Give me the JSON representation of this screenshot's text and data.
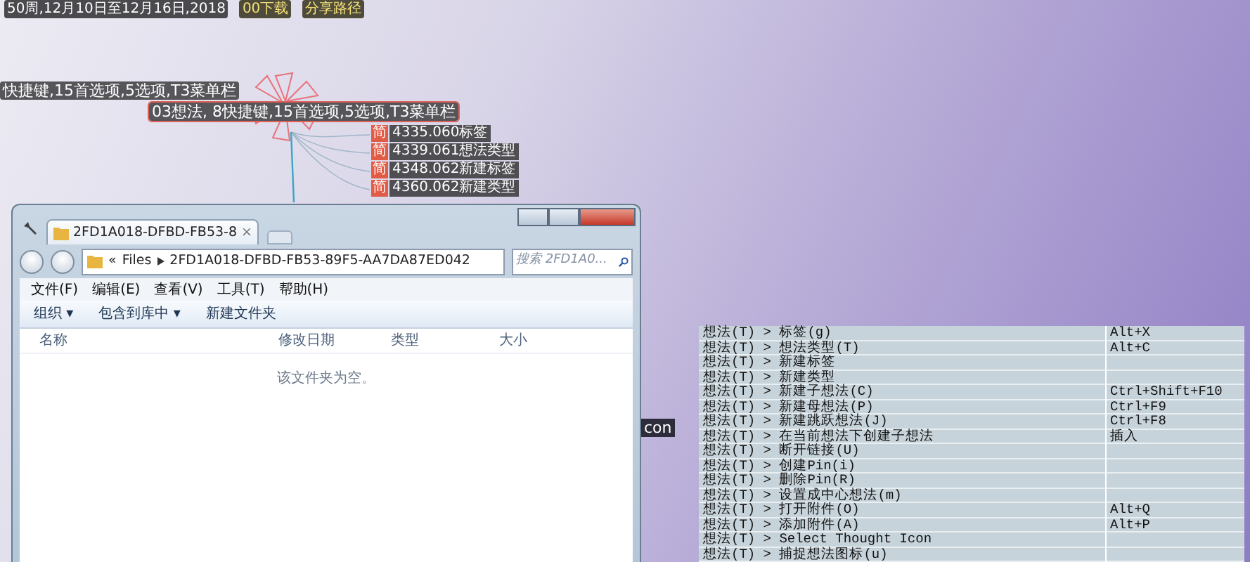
{
  "header_tags": [
    {
      "text": "50周,12月10日至12月16日,2018",
      "kind": "date"
    },
    {
      "text": "00下载",
      "kind": "folder"
    },
    {
      "text": "分享路径",
      "kind": "folder"
    }
  ],
  "thoughts": [
    {
      "text": "快捷键,15首选项,5选项,T3菜单栏",
      "kind": "plain"
    },
    {
      "text": "03想法, 8快捷键,15首选项,5选项,T3菜单栏",
      "kind": "active"
    }
  ],
  "child_thoughts": [
    {
      "badge": "简",
      "text": "4335.060标签"
    },
    {
      "badge": "简",
      "text": "4339.061想法类型"
    },
    {
      "badge": "简",
      "text": "4348.062新建标签"
    },
    {
      "badge": "简",
      "text": "4360.062新建类型"
    }
  ],
  "partial_label": "con",
  "explorer": {
    "tab": "2FD1A018-DFBD-FB53-8",
    "tab_close": "×",
    "address_prefix": "«",
    "breadcrumb": [
      "Files",
      "2FD1A018-DFBD-FB53-89F5-AA7DA87ED042"
    ],
    "search": {
      "placeholder": "搜索 2FD1A0..."
    },
    "menu": [
      "文件(F)",
      "编辑(E)",
      "查看(V)",
      "工具(T)",
      "帮助(H)"
    ],
    "toolbar": [
      {
        "label": "组织",
        "caret": "▾"
      },
      {
        "label": "包含到库中",
        "caret": "▾"
      },
      {
        "label": "新建文件夹"
      }
    ],
    "columns": [
      "名称",
      "修改日期",
      "类型",
      "大小"
    ],
    "empty_message": "该文件夹为空。"
  },
  "shortcuts": {
    "rows": [
      {
        "command": "想法(T) > 标签(g)",
        "shortcut": "Alt+X"
      },
      {
        "command": "想法(T) > 想法类型(T)",
        "shortcut": "Alt+C"
      },
      {
        "command": "想法(T) > 新建标签",
        "shortcut": ""
      },
      {
        "command": "想法(T) > 新建类型",
        "shortcut": ""
      },
      {
        "command": "想法(T) > 新建子想法(C)",
        "shortcut": "Ctrl+Shift+F10"
      },
      {
        "command": "想法(T) > 新建母想法(P)",
        "shortcut": "Ctrl+F9"
      },
      {
        "command": "想法(T) > 新建跳跃想法(J)",
        "shortcut": "Ctrl+F8"
      },
      {
        "command": "想法(T) > 在当前想法下创建子想法",
        "shortcut": "插入"
      },
      {
        "command": "想法(T) > 断开链接(U)",
        "shortcut": ""
      },
      {
        "command": "想法(T) > 创建Pin(i)",
        "shortcut": ""
      },
      {
        "command": "想法(T) > 删除Pin(R)",
        "shortcut": ""
      },
      {
        "command": "想法(T) > 设置成中心想法(m)",
        "shortcut": ""
      },
      {
        "command": "想法(T) > 打开附件(O)",
        "shortcut": "Alt+Q"
      },
      {
        "command": "想法(T) > 添加附件(A)",
        "shortcut": "Alt+P"
      },
      {
        "command": "想法(T) > Select Thought Icon",
        "shortcut": ""
      },
      {
        "command": "想法(T) > 捕捉想法图标(u)",
        "shortcut": ""
      }
    ]
  }
}
